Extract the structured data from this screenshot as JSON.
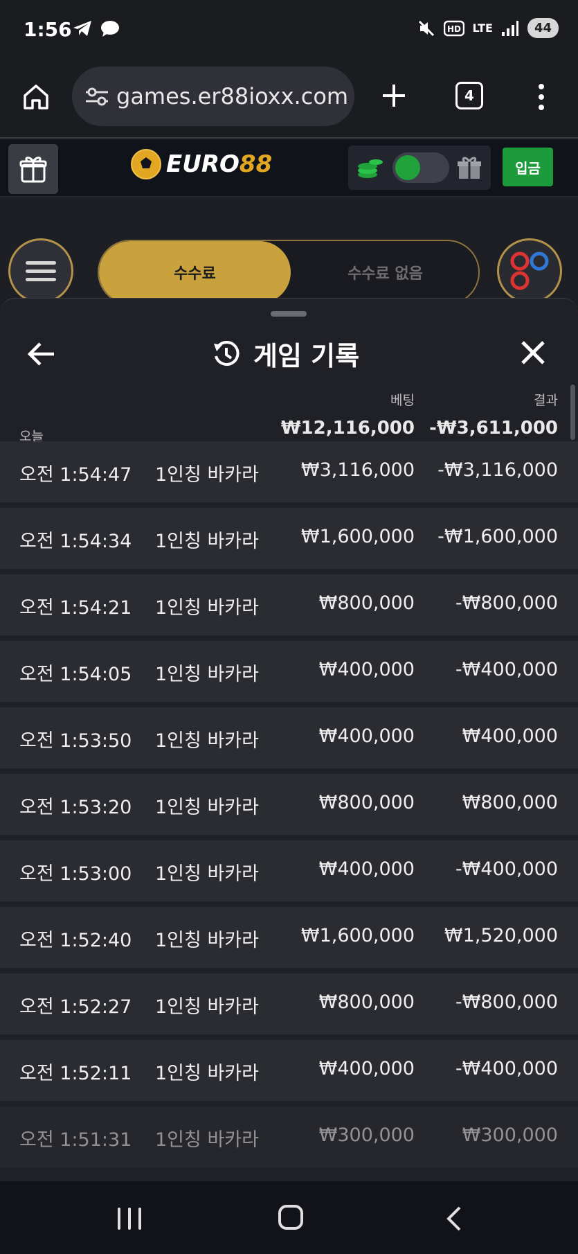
{
  "status_bar": {
    "time": "1:56",
    "network": "LTE",
    "battery": "44"
  },
  "browser": {
    "url": "games.er88ioxx.com",
    "tab_count": "4"
  },
  "site": {
    "logo_text_a": "EURO",
    "logo_text_b": "88",
    "deposit_label": "입금"
  },
  "fee_tabs": {
    "active": "수수료",
    "inactive": "수수료 없음"
  },
  "history": {
    "title": "게임 기록",
    "col_bet": "베팅",
    "col_result": "결과",
    "today_label": "오늘",
    "total_bet": "₩12,116,000",
    "total_result": "-₩3,611,000",
    "rows": [
      {
        "time": "오전 1:54:47",
        "game": "1인칭 바카라",
        "bet": "₩3,116,000",
        "result": "-₩3,116,000"
      },
      {
        "time": "오전 1:54:34",
        "game": "1인칭 바카라",
        "bet": "₩1,600,000",
        "result": "-₩1,600,000"
      },
      {
        "time": "오전 1:54:21",
        "game": "1인칭 바카라",
        "bet": "₩800,000",
        "result": "-₩800,000"
      },
      {
        "time": "오전 1:54:05",
        "game": "1인칭 바카라",
        "bet": "₩400,000",
        "result": "-₩400,000"
      },
      {
        "time": "오전 1:53:50",
        "game": "1인칭 바카라",
        "bet": "₩400,000",
        "result": "₩400,000"
      },
      {
        "time": "오전 1:53:20",
        "game": "1인칭 바카라",
        "bet": "₩800,000",
        "result": "₩800,000"
      },
      {
        "time": "오전 1:53:00",
        "game": "1인칭 바카라",
        "bet": "₩400,000",
        "result": "-₩400,000"
      },
      {
        "time": "오전 1:52:40",
        "game": "1인칭 바카라",
        "bet": "₩1,600,000",
        "result": "₩1,520,000"
      },
      {
        "time": "오전 1:52:27",
        "game": "1인칭 바카라",
        "bet": "₩800,000",
        "result": "-₩800,000"
      },
      {
        "time": "오전 1:52:11",
        "game": "1인칭 바카라",
        "bet": "₩400,000",
        "result": "-₩400,000"
      },
      {
        "time": "오전 1:51:31",
        "game": "1인칭 바카라",
        "bet": "₩300,000",
        "result": "₩300,000"
      }
    ]
  },
  "colors": {
    "accent_gold": "#c9a23e",
    "deposit_green": "#1d9a3a",
    "toggle_green": "#1fa33a"
  }
}
